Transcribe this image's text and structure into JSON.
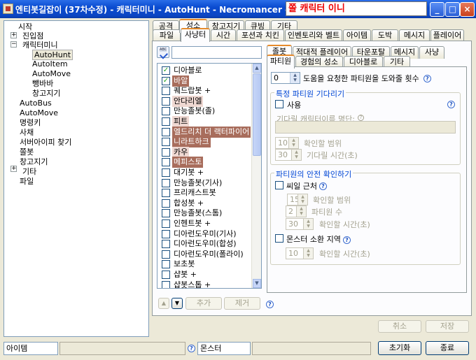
{
  "window": {
    "title": "엔티봇길잡이 (37차수정) - 캐릭터미니 - AutoHunt - Necromancer -",
    "char_name": "쫄 캐릭터 이니",
    "minimize": "_",
    "maximize": "□",
    "close": "×"
  },
  "tree": {
    "items": [
      {
        "label": "시작"
      },
      {
        "label": "진입점"
      },
      {
        "label": "캐릭터미니"
      },
      {
        "label": "AutoHunt"
      },
      {
        "label": "AutoItem"
      },
      {
        "label": "AutoMove"
      },
      {
        "label": "뺑바바"
      },
      {
        "label": "창고지기"
      },
      {
        "label": "AutoBus"
      },
      {
        "label": "AutoMove"
      },
      {
        "label": "명령키"
      },
      {
        "label": "사채"
      },
      {
        "label": "서버아이피 찾기"
      },
      {
        "label": "쫄봇"
      },
      {
        "label": "창고지기"
      },
      {
        "label": "기타"
      },
      {
        "label": "파일"
      }
    ]
  },
  "tabs_row1": [
    "공격",
    "성소",
    "창고지기",
    "큐빙",
    "기타"
  ],
  "tabs_row2": [
    "파일",
    "사냥터",
    "시간",
    "포션과 치킨",
    "인벤토리와 벨트",
    "아이템",
    "도박",
    "메시지",
    "플레이어"
  ],
  "search": {
    "value": ""
  },
  "monsters": [
    {
      "name": "디아블로",
      "checked": true,
      "hl": ""
    },
    {
      "name": "바알",
      "checked": true,
      "hl": "hl1"
    },
    {
      "name": "퀘드랍봇 +",
      "checked": false,
      "hl": ""
    },
    {
      "name": "안다리엘",
      "checked": false,
      "hl": "hl2"
    },
    {
      "name": "만능졸봇(졸)",
      "checked": false,
      "hl": ""
    },
    {
      "name": "피트",
      "checked": false,
      "hl": "hl2"
    },
    {
      "name": "엘드리치 더 랙터파이어",
      "checked": false,
      "hl": "hl1"
    },
    {
      "name": "니라트하크",
      "checked": false,
      "hl": "hl1"
    },
    {
      "name": "카우",
      "checked": false,
      "hl": "hl2"
    },
    {
      "name": "메피스토",
      "checked": false,
      "hl": "hl1"
    },
    {
      "name": "대기봇 +",
      "checked": false,
      "hl": ""
    },
    {
      "name": "만능졸봇(기사)",
      "checked": false,
      "hl": ""
    },
    {
      "name": "프리캐스트봇",
      "checked": false,
      "hl": ""
    },
    {
      "name": "합성봇 +",
      "checked": false,
      "hl": ""
    },
    {
      "name": "만능졸봇(스톰)",
      "checked": false,
      "hl": ""
    },
    {
      "name": "인헨트봇 +",
      "checked": false,
      "hl": ""
    },
    {
      "name": "디아런도우미(기사)",
      "checked": false,
      "hl": ""
    },
    {
      "name": "디아런도우미(합성)",
      "checked": false,
      "hl": ""
    },
    {
      "name": "디아런도우미(폴라이)",
      "checked": false,
      "hl": ""
    },
    {
      "name": "보초봇",
      "checked": false,
      "hl": ""
    },
    {
      "name": "샵봇 +",
      "checked": false,
      "hl": ""
    },
    {
      "name": "샵봇스톱 +",
      "checked": false,
      "hl": ""
    }
  ],
  "list_buttons": {
    "up": "▲",
    "down": "▼",
    "add": "추가",
    "remove": "제거"
  },
  "inner_tabs_row1": [
    "졸봇",
    "적대적 플레이어",
    "타운포탈",
    "메시지",
    "사냥"
  ],
  "inner_tabs_row2": [
    "파티원",
    "경험의 성소",
    "디아블로",
    "기타"
  ],
  "party": {
    "help_count_value": "0",
    "help_count_label": "도움을 요청한 파티원을 도와줄 횟수",
    "wait_group": {
      "title": "특정 파티원 기다리기",
      "use_label": "사용",
      "name_label": "기다릴 캐릭터이름 명단:",
      "range_value": "10",
      "range_label": "확인할 범위",
      "time_value": "30",
      "time_label": "기다릴 시간(초)"
    },
    "safety_group": {
      "title": "파티원의 안전 확인하기",
      "wp_label": "씨일 근처",
      "wp_range_value": "15",
      "wp_range_label": "확인할 범위",
      "wp_count_value": "2",
      "wp_count_label": "파티원 수",
      "wp_time_value": "30",
      "wp_time_label": "확인할 시간(초)",
      "summon_label": "몬스터 소환 지역",
      "summon_time_value": "10",
      "summon_time_label": "확인할 시간(초)"
    }
  },
  "footer": {
    "cancel": "취소",
    "save": "저장",
    "status_left": "아이템",
    "status_mid": "몬스터",
    "reset": "초기화",
    "exit": "종료"
  },
  "colors": {
    "titlebar": "#0a4bd0",
    "highlight_dark": "#a86d5c",
    "highlight_light": "#efd8d2",
    "group_title": "#0046d5"
  }
}
